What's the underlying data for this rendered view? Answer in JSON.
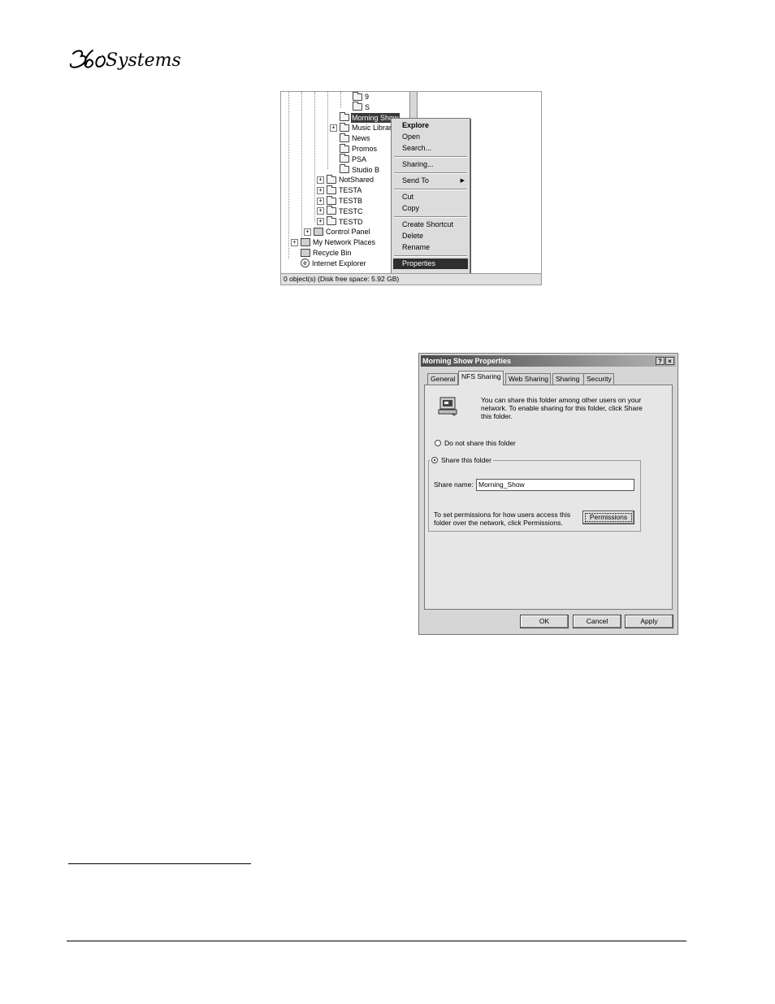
{
  "logo_alt": "360 Systems",
  "explorer": {
    "tree": [
      {
        "label": "9",
        "indent": 5,
        "icon": "folder-icon",
        "expander": "",
        "selected": false
      },
      {
        "label": "S",
        "indent": 5,
        "icon": "folder-icon",
        "expander": "",
        "selected": false
      },
      {
        "label": "Morning Show",
        "indent": 4,
        "icon": "folder-open-icon",
        "expander": "",
        "selected": true
      },
      {
        "label": "Music Library",
        "indent": 4,
        "icon": "folder-icon",
        "expander": "+",
        "selected": false
      },
      {
        "label": "News",
        "indent": 4,
        "icon": "folder-icon",
        "expander": "",
        "selected": false
      },
      {
        "label": "Promos",
        "indent": 4,
        "icon": "folder-icon",
        "expander": "",
        "selected": false
      },
      {
        "label": "PSA",
        "indent": 4,
        "icon": "folder-icon",
        "expander": "",
        "selected": false
      },
      {
        "label": "Studio B",
        "indent": 4,
        "icon": "folder-icon",
        "expander": "",
        "selected": false
      },
      {
        "label": "NotShared",
        "indent": 3,
        "icon": "folder-icon",
        "expander": "+",
        "selected": false
      },
      {
        "label": "TESTA",
        "indent": 3,
        "icon": "shared-folder-icon",
        "expander": "+",
        "selected": false
      },
      {
        "label": "TESTB",
        "indent": 3,
        "icon": "shared-folder-icon",
        "expander": "+",
        "selected": false
      },
      {
        "label": "TESTC",
        "indent": 3,
        "icon": "folder-icon",
        "expander": "+",
        "selected": false
      },
      {
        "label": "TESTD",
        "indent": 3,
        "icon": "folder-icon",
        "expander": "+",
        "selected": false
      },
      {
        "label": "Control Panel",
        "indent": 2,
        "icon": "control-panel-icon",
        "expander": "+",
        "selected": false
      },
      {
        "label": "My Network Places",
        "indent": 1,
        "icon": "network-places-icon",
        "expander": "+",
        "selected": false
      },
      {
        "label": "Recycle Bin",
        "indent": 1,
        "icon": "recycle-bin-icon",
        "expander": "",
        "selected": false
      },
      {
        "label": "Internet Explorer",
        "indent": 1,
        "icon": "internet-explorer-icon",
        "expander": "",
        "selected": false
      }
    ],
    "status": "0 object(s) (Disk free space: 5.92 GB)",
    "context_menu": [
      {
        "label": "Explore",
        "bold": true,
        "highlight": false,
        "arrow": "",
        "sep_after": false
      },
      {
        "label": "Open",
        "bold": false,
        "highlight": false,
        "arrow": "",
        "sep_after": false
      },
      {
        "label": "Search...",
        "bold": false,
        "highlight": false,
        "arrow": "",
        "sep_after": true
      },
      {
        "label": "Sharing...",
        "bold": false,
        "highlight": false,
        "arrow": "",
        "sep_after": true
      },
      {
        "label": "Send To",
        "bold": false,
        "highlight": false,
        "arrow": "▶",
        "sep_after": true
      },
      {
        "label": "Cut",
        "bold": false,
        "highlight": false,
        "arrow": "",
        "sep_after": false
      },
      {
        "label": "Copy",
        "bold": false,
        "highlight": false,
        "arrow": "",
        "sep_after": true
      },
      {
        "label": "Create Shortcut",
        "bold": false,
        "highlight": false,
        "arrow": "",
        "sep_after": false
      },
      {
        "label": "Delete",
        "bold": false,
        "highlight": false,
        "arrow": "",
        "sep_after": false
      },
      {
        "label": "Rename",
        "bold": false,
        "highlight": false,
        "arrow": "",
        "sep_after": true
      },
      {
        "label": "Properties",
        "bold": false,
        "highlight": true,
        "arrow": "",
        "sep_after": false
      }
    ]
  },
  "dialog": {
    "title": "Morning Show Properties",
    "help_glyph": "?",
    "close_glyph": "×",
    "tabs": [
      {
        "label": "General",
        "active": false
      },
      {
        "label": "NFS Sharing",
        "active": true
      },
      {
        "label": "Web Sharing",
        "active": false
      },
      {
        "label": "Sharing",
        "active": false
      },
      {
        "label": "Security",
        "active": false
      }
    ],
    "info_text": "You can share this folder among other users on your network. To enable sharing for this folder, click Share this folder.",
    "do_not_share_label": "Do not share this folder",
    "share_label": "Share this folder",
    "share_selected": true,
    "share_name_label": "Share name:",
    "share_name_value": "Morning_Show",
    "permissions_text": "To set permissions for how users access this folder over the network, click Permissions.",
    "permissions_button": "Permissions",
    "ok_button": "OK",
    "cancel_button": "Cancel",
    "apply_button": "Apply"
  }
}
